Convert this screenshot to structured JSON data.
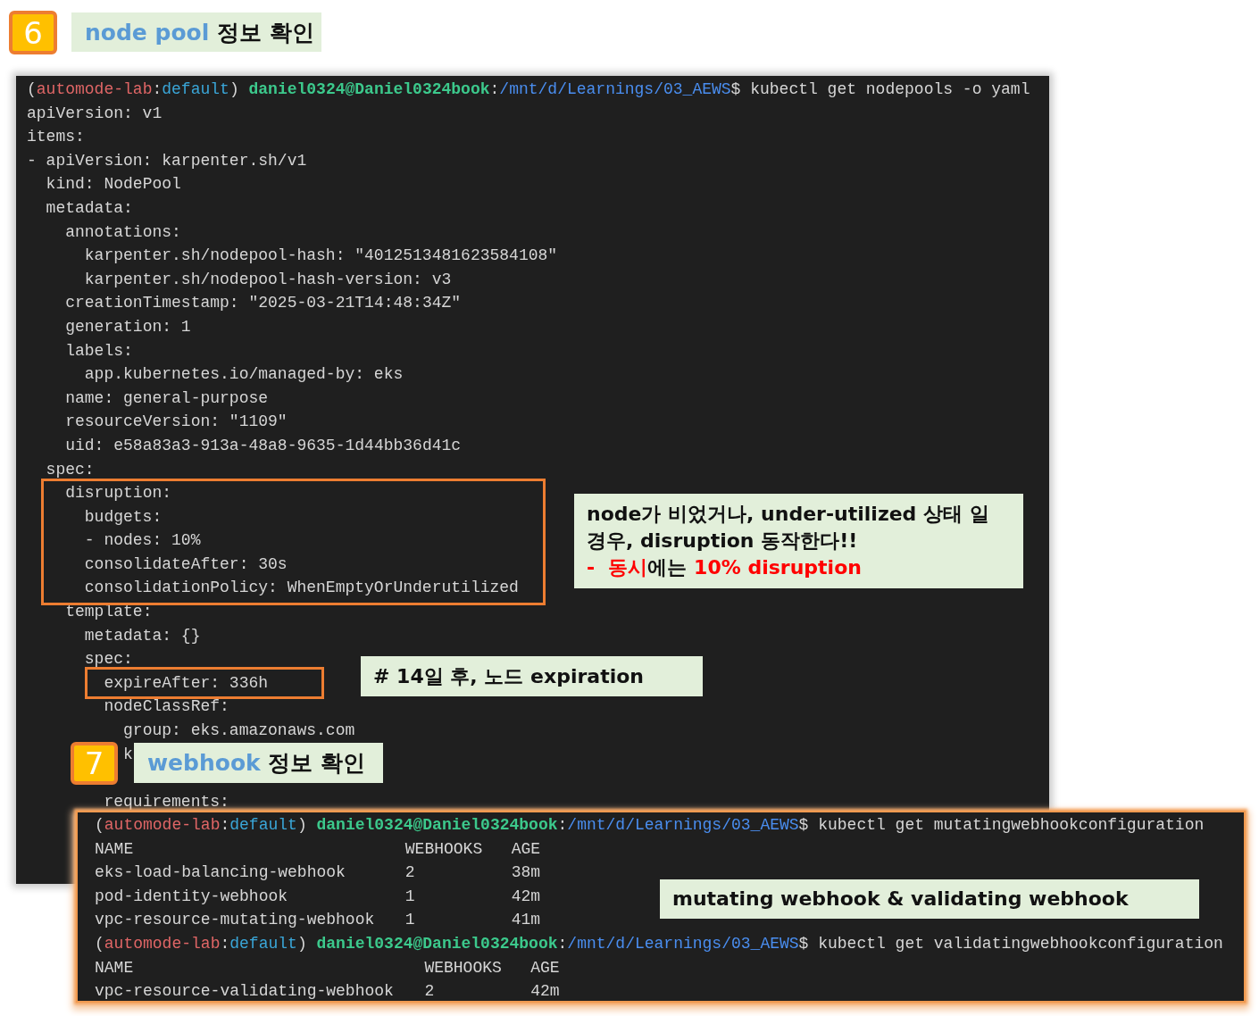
{
  "step_6": {
    "number": "6",
    "title": [
      {
        "text": "node pool",
        "accent": true
      },
      {
        "text": " 정보 확인",
        "accent": false
      }
    ]
  },
  "terminal_1": {
    "prompt": [
      {
        "text": "(",
        "kind": "plain"
      },
      {
        "text": "automode-lab",
        "kind": "env"
      },
      {
        "text": ":",
        "kind": "plain"
      },
      {
        "text": "default",
        "kind": "ns"
      },
      {
        "text": ") ",
        "kind": "plain"
      },
      {
        "text": "daniel0324@Daniel0324book",
        "kind": "user"
      },
      {
        "text": ":",
        "kind": "plain"
      },
      {
        "text": "/mnt/d/Learnings/03_AEWS",
        "kind": "path"
      },
      {
        "text": "$ kubectl get nodepools -o yaml",
        "kind": "plain"
      }
    ],
    "lines": [
      "apiVersion: v1",
      "items:",
      "- apiVersion: karpenter.sh/v1",
      "  kind: NodePool",
      "  metadata:",
      "    annotations:",
      "      karpenter.sh/nodepool-hash: \"4012513481623584108\"",
      "      karpenter.sh/nodepool-hash-version: v3",
      "    creationTimestamp: \"2025-03-21T14:48:34Z\"",
      "    generation: 1",
      "    labels:",
      "      app.kubernetes.io/managed-by: eks",
      "    name: general-purpose",
      "    resourceVersion: \"1109\"",
      "    uid: e58a83a3-913a-48a8-9635-1d44bb36d41c",
      "  spec:",
      "    disruption:",
      "      budgets:",
      "      - nodes: 10%",
      "      consolidateAfter: 30s",
      "      consolidationPolicy: WhenEmptyOrUnderutilized",
      "    template:",
      "      metadata: {}",
      "      spec:",
      "        expireAfter: 336h",
      "        nodeClassRef:",
      "          group: eks.amazonaws.com",
      "          k",
      "        requirements:"
    ]
  },
  "disruption_note": {
    "lines": [
      "node가 비었거나, under-utilized 상태 일",
      "경우, disruption 동작한다!!"
    ],
    "emphasis_line": [
      {
        "text": "-  동시",
        "red": true
      },
      {
        "text": "에는",
        "red": false
      },
      {
        "text": " 10% disruption",
        "red": true
      }
    ]
  },
  "expire_note": "# 14일 후, 노드 expiration",
  "step_7": {
    "number": "7",
    "title": [
      {
        "text": "webhook",
        "accent": true
      },
      {
        "text": " 정보 확인",
        "accent": false
      }
    ]
  },
  "terminal_2": {
    "blocks": [
      {
        "prompt": [
          {
            "text": "(",
            "kind": "plain"
          },
          {
            "text": "automode-lab",
            "kind": "env"
          },
          {
            "text": ":",
            "kind": "plain"
          },
          {
            "text": "default",
            "kind": "ns"
          },
          {
            "text": ") ",
            "kind": "plain"
          },
          {
            "text": "daniel0324@Daniel0324book",
            "kind": "user"
          },
          {
            "text": ":",
            "kind": "plain"
          },
          {
            "text": "/mnt/d/Learnings/03_AEWS",
            "kind": "path"
          },
          {
            "text": "$ kubectl get mutatingwebhookconfiguration",
            "kind": "plain"
          }
        ],
        "columns": [
          "NAME",
          "WEBHOOKS",
          "AGE"
        ],
        "rows": [
          [
            "eks-load-balancing-webhook",
            "2",
            "38m"
          ],
          [
            "pod-identity-webhook",
            "1",
            "42m"
          ],
          [
            "vpc-resource-mutating-webhook",
            "1",
            "41m"
          ]
        ]
      },
      {
        "prompt": [
          {
            "text": "(",
            "kind": "plain"
          },
          {
            "text": "automode-lab",
            "kind": "env"
          },
          {
            "text": ":",
            "kind": "plain"
          },
          {
            "text": "default",
            "kind": "ns"
          },
          {
            "text": ") ",
            "kind": "plain"
          },
          {
            "text": "daniel0324@Daniel0324book",
            "kind": "user"
          },
          {
            "text": ":",
            "kind": "plain"
          },
          {
            "text": "/mnt/d/Learnings/03_AEWS",
            "kind": "path"
          },
          {
            "text": "$ kubectl get validatingwebhookconfiguration",
            "kind": "plain"
          }
        ],
        "columns": [
          "NAME",
          "WEBHOOKS",
          "AGE"
        ],
        "rows": [
          [
            "vpc-resource-validating-webhook",
            "2",
            "42m"
          ]
        ]
      }
    ]
  },
  "webhook_note": "mutating webhook & validating webhook"
}
